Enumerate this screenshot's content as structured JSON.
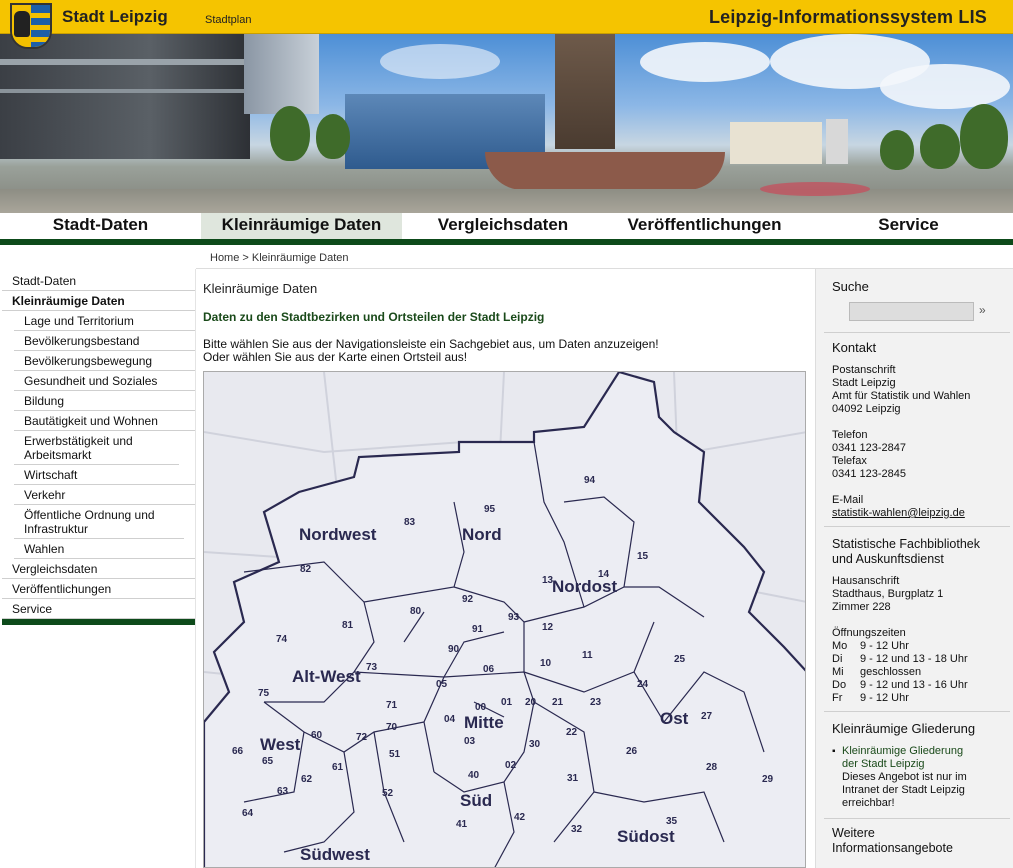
{
  "header": {
    "brand": "Stadt Leipzig",
    "stadtplan": "Stadtplan",
    "system_title": "Leipzig-Informationssystem LIS"
  },
  "mainnav": {
    "tabs": [
      {
        "label": "Stadt-Daten"
      },
      {
        "label": "Kleinräumige Daten"
      },
      {
        "label": "Vergleichsdaten"
      },
      {
        "label": "Veröffentlichungen"
      },
      {
        "label": "Service"
      }
    ],
    "active_index": 1
  },
  "breadcrumb": {
    "home": "Home",
    "sep": ">",
    "current": "Kleinräumige Daten"
  },
  "leftnav": {
    "items": [
      {
        "label": "Stadt-Daten"
      },
      {
        "label": "Kleinräumige Daten"
      },
      {
        "label": "Lage und Territorium"
      },
      {
        "label": "Bevölkerungsbestand"
      },
      {
        "label": "Bevölkerungsbewegung"
      },
      {
        "label": "Gesundheit und Soziales"
      },
      {
        "label": "Bildung"
      },
      {
        "label": "Bautätigkeit und Wohnen"
      },
      {
        "label": "Erwerbstätigkeit und Arbeitsmarkt"
      },
      {
        "label": "Wirtschaft"
      },
      {
        "label": "Verkehr"
      },
      {
        "label": "Öffentliche Ordnung und Infrastruktur"
      },
      {
        "label": "Wahlen"
      },
      {
        "label": "Vergleichsdaten"
      },
      {
        "label": "Veröffentlichungen"
      },
      {
        "label": "Service"
      }
    ]
  },
  "content": {
    "title": "Kleinräumige Daten",
    "subhead": "Daten zu den Stadtbezirken und Ortsteilen der Stadt Leipzig",
    "intro_line1": "Bitte wählen Sie aus der Navigationsleiste ein Sachgebiet aus, um Daten anzuzeigen!",
    "intro_line2": "Oder wählen Sie aus der Karte einen Ortsteil aus!"
  },
  "map": {
    "districts": [
      "Nordwest",
      "Nord",
      "Nordost",
      "Alt-West",
      "Mitte",
      "Ost",
      "West",
      "Süd",
      "Südost",
      "Südwest"
    ],
    "numbers": [
      "95",
      "94",
      "83",
      "82",
      "15",
      "13",
      "14",
      "92",
      "81",
      "80",
      "93",
      "12",
      "91",
      "74",
      "90",
      "73",
      "06",
      "10",
      "11",
      "25",
      "75",
      "05",
      "00",
      "01",
      "20",
      "21",
      "24",
      "71",
      "04",
      "23",
      "70",
      "72",
      "03",
      "30",
      "22",
      "27",
      "66",
      "60",
      "65",
      "61",
      "51",
      "02",
      "26",
      "28",
      "62",
      "63",
      "40",
      "31",
      "29",
      "52",
      "64",
      "41",
      "42",
      "32",
      "35"
    ]
  },
  "rightcol": {
    "search_head": "Suche",
    "search_go": "»",
    "kontakt_head": "Kontakt",
    "postanschrift": "Postanschrift",
    "addr1": "Stadt Leipzig",
    "addr2": "Amt für Statistik und Wahlen",
    "addr3": "04092 Leipzig",
    "telefon_label": "Telefon",
    "telefon": "0341 123-2847",
    "telefax_label": "Telefax",
    "telefax": "0341 123-2845",
    "email_label": "E-Mail",
    "email": "statistik-wahlen@leipzig.de",
    "bib_head1": "Statistische Fachbibliothek",
    "bib_head2": "und Auskunftsdienst",
    "hausanschrift": "Hausanschrift",
    "haus1": "Stadthaus, Burgplatz 1",
    "haus2": "Zimmer 228",
    "oeffnung_label": "Öffnungszeiten",
    "hours": [
      {
        "day": "Mo",
        "time": "9 - 12 Uhr"
      },
      {
        "day": "Di",
        "time": "9 - 12 und 13 - 18 Uhr"
      },
      {
        "day": "Mi",
        "time": "geschlossen"
      },
      {
        "day": "Do",
        "time": "9 - 12 und 13 - 16 Uhr"
      },
      {
        "day": "Fr",
        "time": "9 - 12 Uhr"
      }
    ],
    "glied_head": "Kleinräumige Gliederung",
    "glied_link1": "Kleinräumige Gliederung",
    "glied_link2": "der Stadt Leipzig",
    "glied_note1": "Dieses Angebot ist nur im",
    "glied_note2": "Intranet der Stadt Leipzig",
    "glied_note3": "erreichbar!",
    "weitere1": "Weitere",
    "weitere2": "Informationsangebote"
  }
}
